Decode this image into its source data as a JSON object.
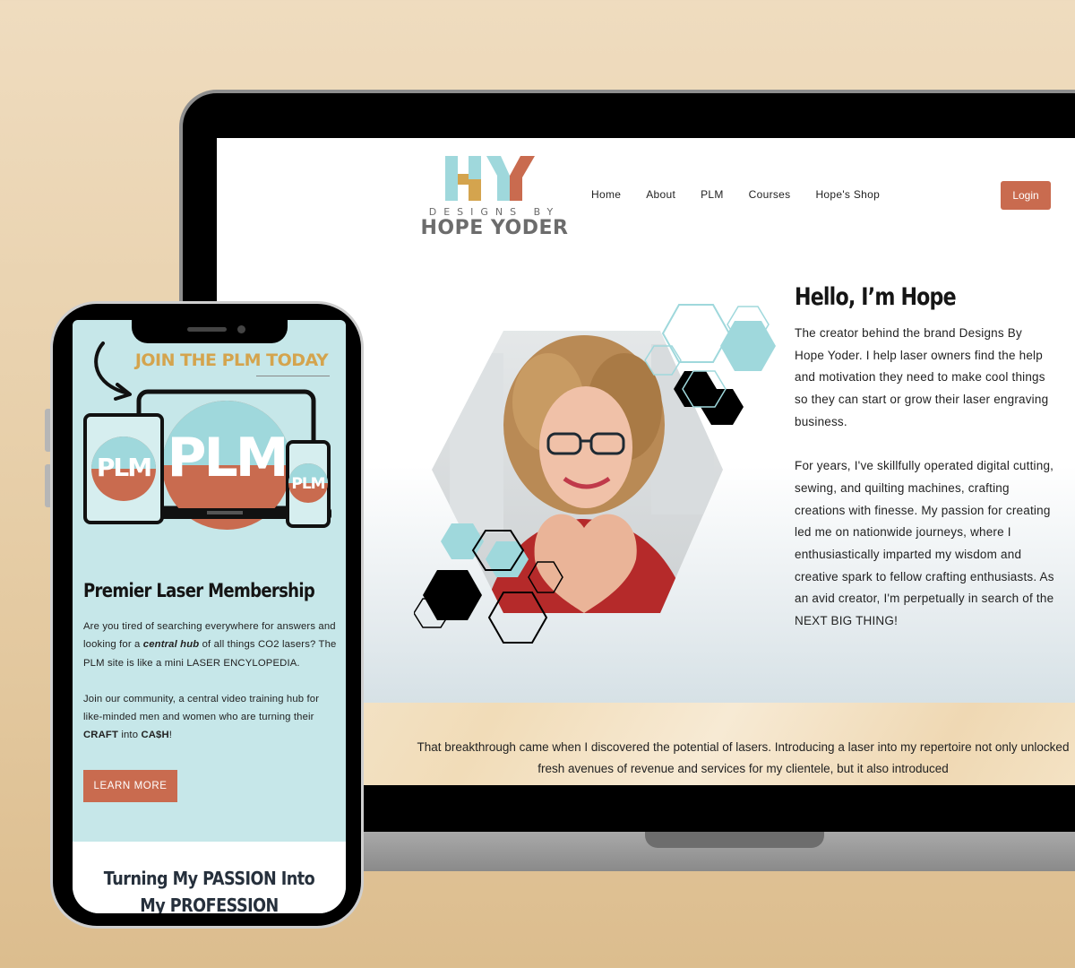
{
  "site": {
    "logo": {
      "initials": "HY",
      "subtitle": "DESIGNS BY",
      "name": "HOPE YODER"
    },
    "nav": [
      "Home",
      "About",
      "PLM",
      "Courses",
      "Hope's Shop"
    ],
    "login_label": "Login",
    "hero": {
      "heading": "Hello, I’m Hope",
      "paragraph1": "The creator behind the brand Designs By Hope Yoder. I help laser owners find the help and motivation they need to make cool things so they can start or grow their laser engraving business.",
      "paragraph2": "For years, I've skillfully operated digital cutting, sewing, and quilting machines, crafting creations with finesse. My passion for creating led me on nationwide journeys, where I enthusiastically imparted my wisdom and creative spark to fellow crafting enthusiasts. As an avid creator, I'm perpetually in search of the NEXT BIG THING!"
    },
    "breakthrough_text": "That breakthrough came when I discovered the potential of lasers. Introducing a laser into my repertoire not only unlocked fresh avenues of revenue and services for my clientele, but it also introduced"
  },
  "mobile": {
    "banner": "JOIN THE PLM TODAY",
    "plm_logo": "PLM",
    "title": "Premier Laser Membership",
    "para1_a": "Are you tired of searching everywhere for answers and looking for a ",
    "para1_em": "central hub",
    "para1_b": " of all things CO2 lasers? The PLM site is like a mini LASER ENCYLOPEDIA.",
    "para2_a": "Join our community, a central video training hub for like-minded men and women who are turning their ",
    "para2_craft": "CRAFT",
    "para2_into": " into ",
    "para2_cash": "CA$H",
    "para2_end": "!",
    "button_label": "LEARN MORE",
    "passion_title": "Turning My PASSION Into My PROFESSION"
  },
  "colors": {
    "accent": "#c96b4f",
    "teal": "#9fd8dc",
    "gold": "#d4a44e",
    "mobile_bg": "#c6e7e9",
    "background": "#e6cda6"
  }
}
